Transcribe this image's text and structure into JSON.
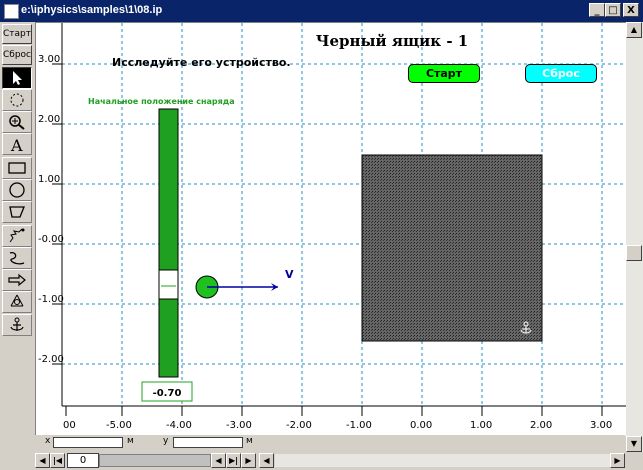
{
  "window": {
    "title": "e:\\iphysics\\samples\\1\\08.ip",
    "minimize": "_",
    "maximize": "□",
    "close": "X"
  },
  "toolbar": {
    "start_label": "Старт",
    "reset_label": "Сброс",
    "tools": [
      "arrow-icon",
      "rotate-icon",
      "zoom-icon",
      "text-icon",
      "rectangle-icon",
      "circle-icon",
      "polygon-icon",
      "spring-icon",
      "rope-icon",
      "force-icon",
      "pendulum-icon",
      "anchor-icon"
    ]
  },
  "scene": {
    "title": "Черный ящик - 1",
    "subtitle": "Исследуйте его устройство.",
    "start_button": "Старт",
    "reset_button": "Сброс",
    "slider_label": "Начальное положение снаряда",
    "slider_value": "-0.70",
    "vector_label": "V",
    "colors": {
      "grid": "#1e90c8",
      "green": "#20a020",
      "start_btn": "#00ff00",
      "reset_btn": "#00ffff",
      "vector": "#0000a0",
      "box": "#555555"
    }
  },
  "axes": {
    "x_ticks": [
      "-5.00",
      "-4.00",
      "-3.00",
      "-2.00",
      "-1.00",
      "0.00",
      "1.00",
      "2.00",
      "3.00"
    ],
    "x_partial": "00",
    "y_ticks": [
      "3.00",
      "2.00",
      "1.00",
      "-0.00",
      "-1.00",
      "-2.00"
    ]
  },
  "coords": {
    "x_label": "x",
    "x_unit": "м",
    "y_label": "y",
    "y_unit": "м"
  },
  "scroll": {
    "page": "0"
  }
}
